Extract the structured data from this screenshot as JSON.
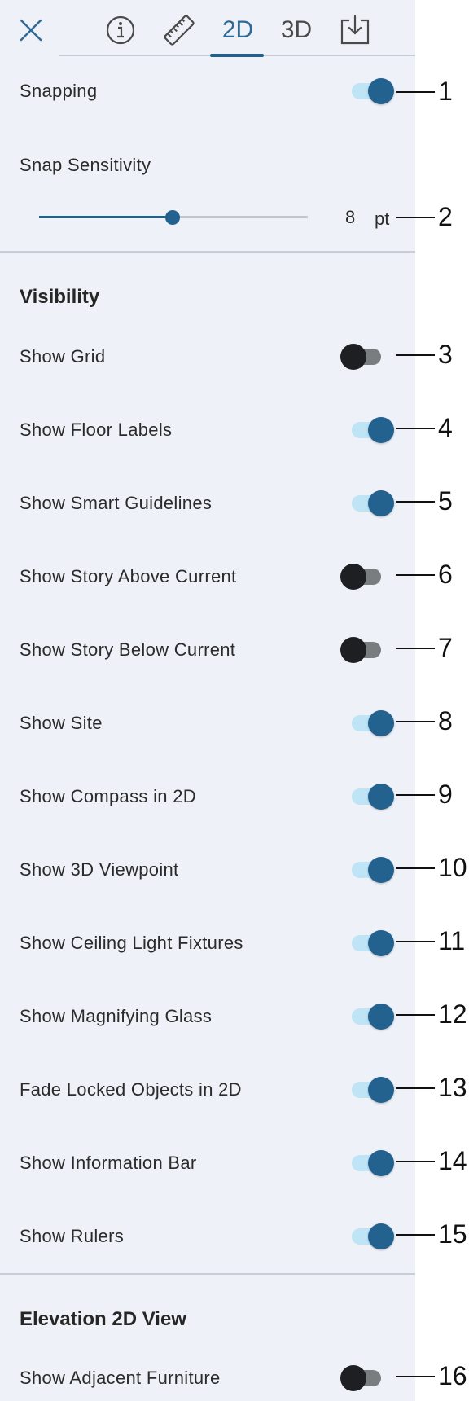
{
  "tabs": [
    {
      "name": "close",
      "icon": "close-icon"
    },
    {
      "name": "info",
      "icon": "info-icon"
    },
    {
      "name": "measure",
      "icon": "ruler-icon"
    },
    {
      "name": "2d",
      "label": "2D",
      "active": true
    },
    {
      "name": "3d",
      "label": "3D"
    },
    {
      "name": "export",
      "icon": "download-icon"
    }
  ],
  "snapping": {
    "label": "Snapping",
    "on": true,
    "callout": "1"
  },
  "snap_sensitivity": {
    "label": "Snap Sensitivity",
    "value": "8",
    "unit": "pt",
    "fraction": 0.5,
    "callout": "2"
  },
  "visibility": {
    "title": "Visibility",
    "items": [
      {
        "label": "Show Grid",
        "on": false,
        "callout": "3"
      },
      {
        "label": "Show Floor Labels",
        "on": true,
        "callout": "4"
      },
      {
        "label": "Show Smart Guidelines",
        "on": true,
        "callout": "5"
      },
      {
        "label": "Show Story Above Current",
        "on": false,
        "callout": "6"
      },
      {
        "label": "Show Story Below Current",
        "on": false,
        "callout": "7"
      },
      {
        "label": "Show Site",
        "on": true,
        "callout": "8"
      },
      {
        "label": "Show Compass in 2D",
        "on": true,
        "callout": "9"
      },
      {
        "label": "Show 3D Viewpoint",
        "on": true,
        "callout": "10"
      },
      {
        "label": "Show Ceiling Light Fixtures",
        "on": true,
        "callout": "11"
      },
      {
        "label": "Show Magnifying Glass",
        "on": true,
        "callout": "12"
      },
      {
        "label": "Fade Locked Objects in 2D",
        "on": true,
        "callout": "13"
      },
      {
        "label": "Show Information Bar",
        "on": true,
        "callout": "14"
      },
      {
        "label": "Show Rulers",
        "on": true,
        "callout": "15"
      }
    ]
  },
  "elevation": {
    "title": "Elevation 2D View",
    "items": [
      {
        "label": "Show Adjacent Furniture",
        "on": false,
        "callout": "16"
      }
    ]
  },
  "colors": {
    "accent": "#23628e",
    "track_on": "#bfe4f6",
    "knob_off": "#1e1f22",
    "panel_bg": "#eef1f7"
  }
}
